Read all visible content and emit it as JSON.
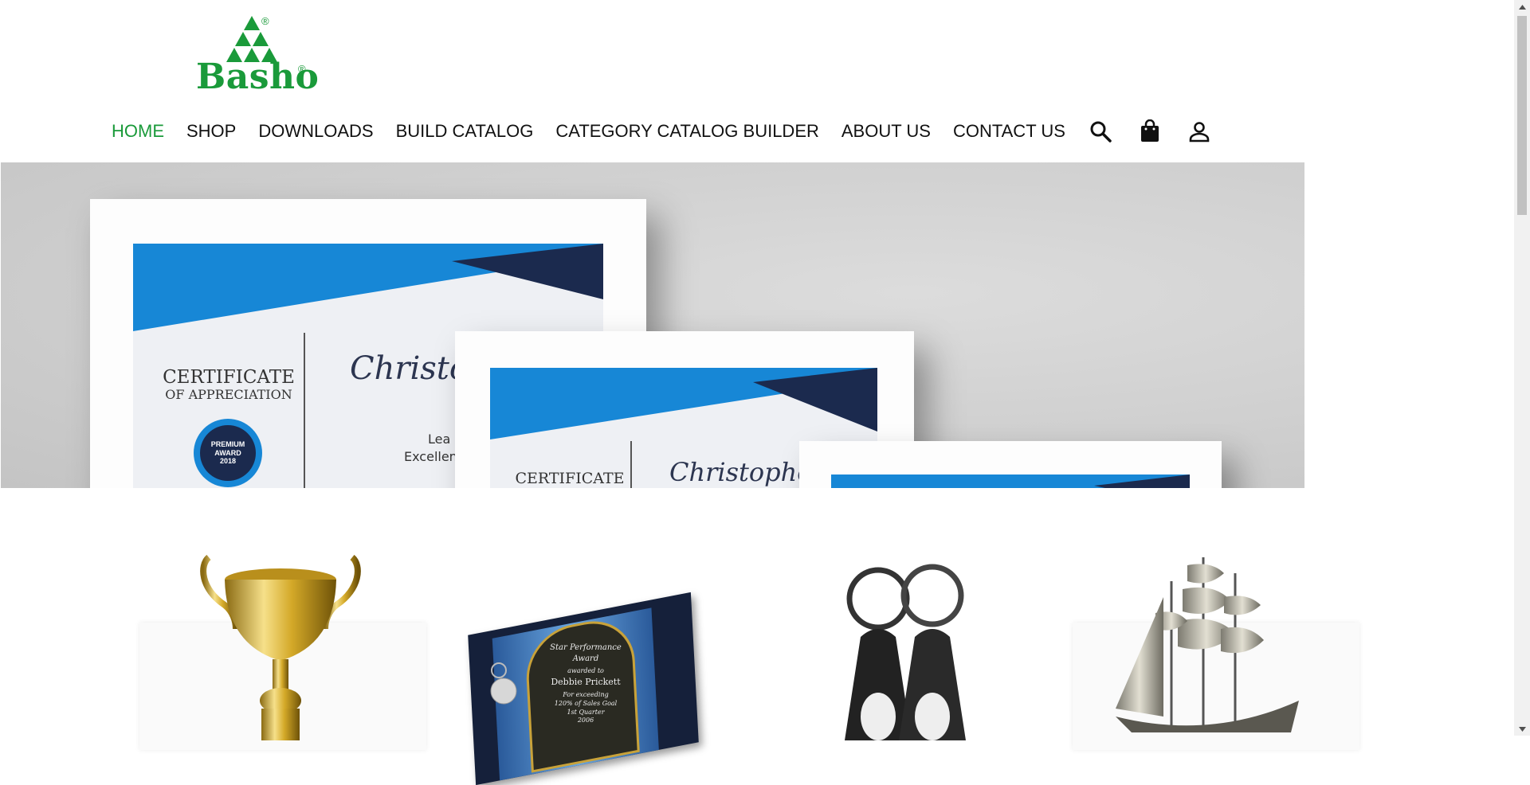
{
  "brand": {
    "name": "Basho",
    "registered_mark": "®",
    "color": "#1a9a3a"
  },
  "nav": {
    "items": [
      {
        "label": "HOME",
        "active": true
      },
      {
        "label": "SHOP"
      },
      {
        "label": "DOWNLOADS"
      },
      {
        "label": "BUILD CATALOG"
      },
      {
        "label": "CATEGORY CATALOG BUILDER"
      },
      {
        "label": "ABOUT US"
      },
      {
        "label": "CONTACT US"
      }
    ],
    "icons": [
      "search-icon",
      "shopping-bag-icon",
      "account-icon"
    ]
  },
  "hero": {
    "cert1": {
      "title": "CERTIFICATE",
      "subtitle": "OF APPRECIATION",
      "name": "Christophe",
      "text1": "Lea",
      "text2": "Excellen",
      "seal1": "PREMIUM",
      "seal2": "AWARD",
      "seal3": "2018"
    },
    "cert2": {
      "title": "CERTIFICATE",
      "name": "Christopher M"
    }
  },
  "products": {
    "plaque": {
      "line1": "Star Performance",
      "line2": "Award",
      "line3": "awarded to",
      "line4": "Debbie Prickett",
      "line5": "For exceeding",
      "line6": "120% of Sales Goal",
      "line7": "1st Quarter",
      "line8": "2006"
    }
  }
}
